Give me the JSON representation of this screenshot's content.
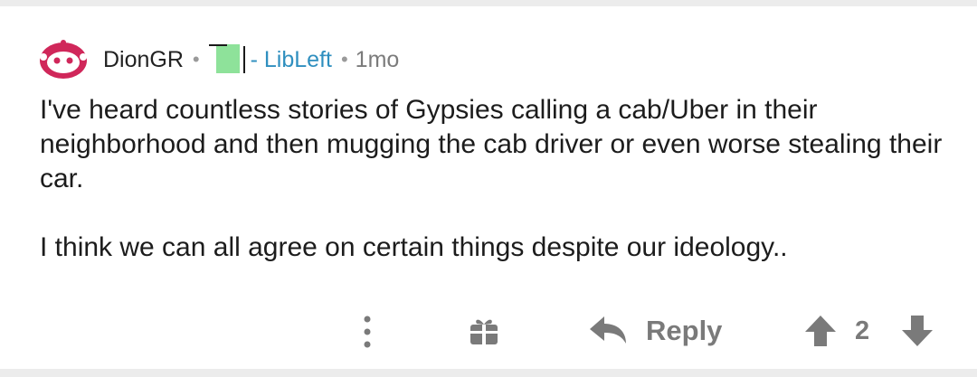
{
  "comment": {
    "username": "DionGR",
    "separator": "•",
    "flair_text": "- LibLeft",
    "time": "1mo",
    "body": [
      "I've heard countless stories of Gypsies calling a cab/Uber in their neighborhood and then mugging the cab driver or even worse stealing their car.",
      "I think we can all agree on certain things despite our ideology.."
    ]
  },
  "actions": {
    "reply_label": "Reply",
    "score": "2",
    "icons": [
      "more-options-icon",
      "gift-icon",
      "reply-arrow-icon",
      "upvote-icon",
      "downvote-icon"
    ]
  },
  "colors": {
    "avatar": "#d0275a",
    "flair_square": "#8ee29a",
    "flair_text": "#2f8fbf",
    "meta": "#7b7b7b",
    "action": "#7a7a7a",
    "background": "#ececec"
  }
}
